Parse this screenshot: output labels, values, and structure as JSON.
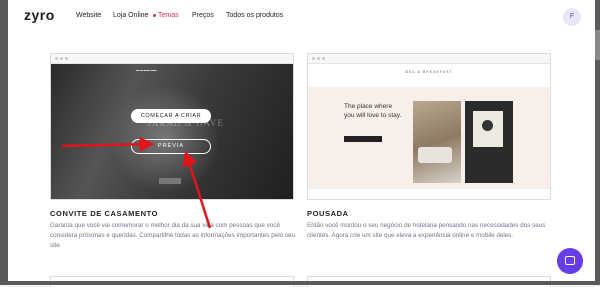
{
  "nav": {
    "logo": "zyro",
    "links": [
      "Website",
      "Loja Online",
      "Temas",
      "Preços",
      "Todos os produtos"
    ],
    "active_link": "Temas",
    "avatar_letter": "F"
  },
  "cards": [
    {
      "title": "CONVITE DE CASAMENTO",
      "description": "Garanta que você vai comemorar o melhor dia da sua vida com pessoas que você considera próximas e queridas. Compartilhe todas as informações importantes pelo seu site.",
      "preview": {
        "heading": "SARAH & DAVE",
        "start_button": "COMEÇAR A CRIAR",
        "preview_button": "PRÉVIA"
      }
    },
    {
      "title": "POUSADA",
      "description": "Então você montou o seu negócio de hotelaria pensando nas necessidades dos seus clientes. Agora crie um site que eleva a experiência online e mobile deles.",
      "preview": {
        "brand": "BED & BREAKFAST",
        "tagline": "The place where you will love to stay."
      }
    }
  ],
  "colors": {
    "accent": "#d63163",
    "chat": "#673de6",
    "arrow": "#e3121b"
  },
  "icons": {
    "chat": "chat-bubble-icon"
  }
}
